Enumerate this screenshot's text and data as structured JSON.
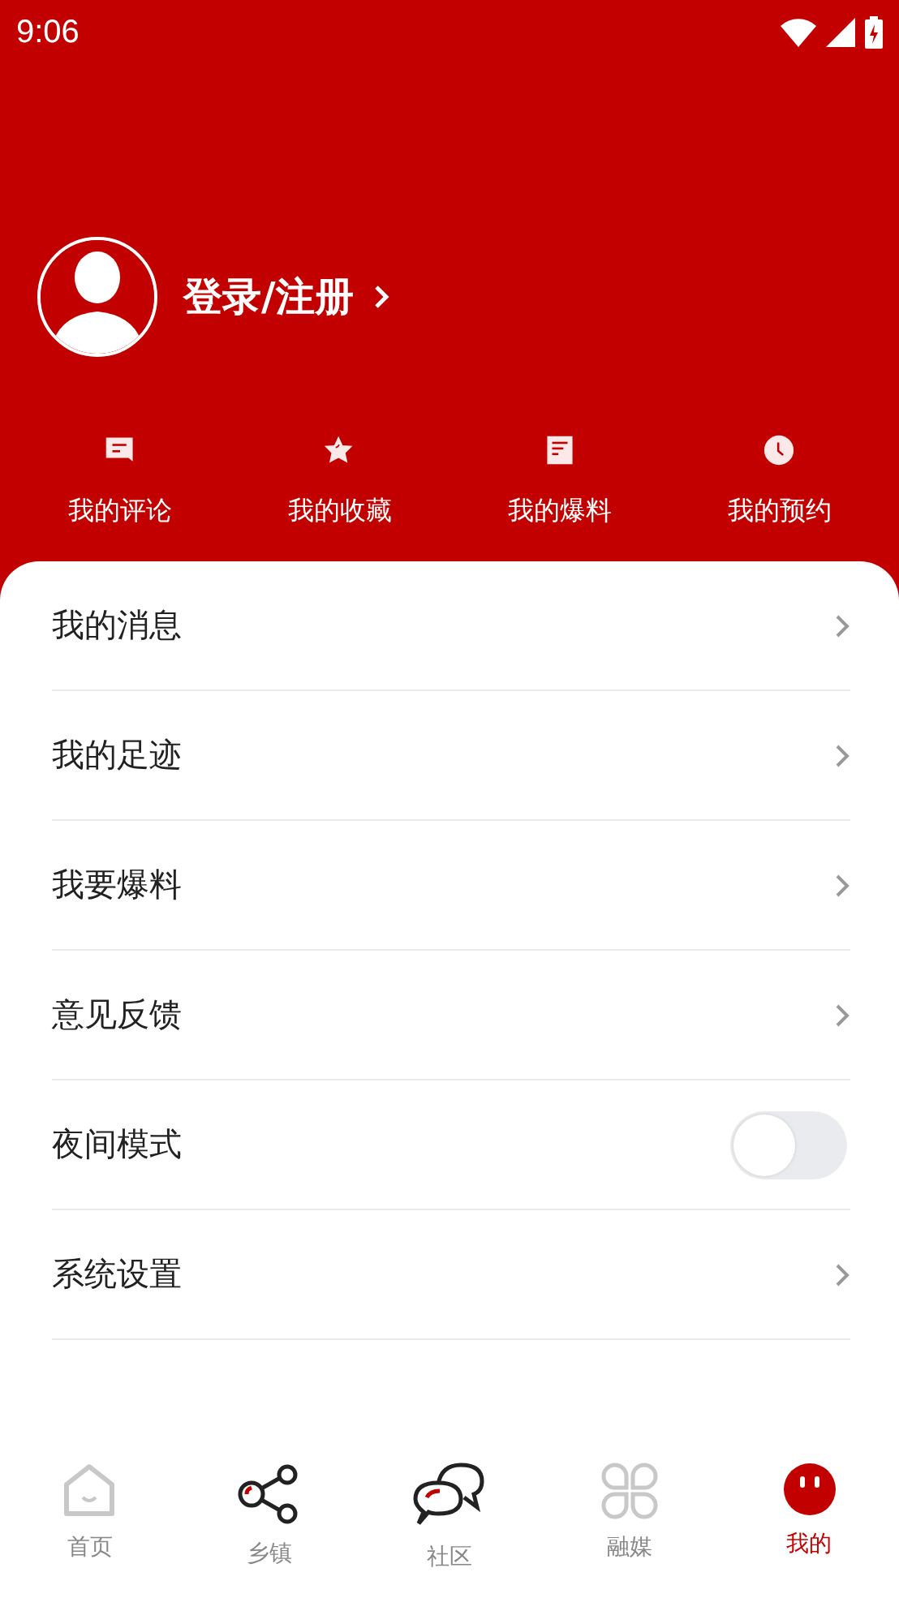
{
  "status_bar": {
    "time": "9:06"
  },
  "profile": {
    "login_label": "登录/注册"
  },
  "shortcuts": [
    {
      "label": "我的评论"
    },
    {
      "label": "我的收藏"
    },
    {
      "label": "我的爆料"
    },
    {
      "label": "我的预约"
    }
  ],
  "menu": [
    {
      "kind": "link",
      "label": "我的消息"
    },
    {
      "kind": "link",
      "label": "我的足迹"
    },
    {
      "kind": "link",
      "label": "我要爆料"
    },
    {
      "kind": "link",
      "label": "意见反馈"
    },
    {
      "kind": "toggle",
      "label": "夜间模式",
      "on": false
    },
    {
      "kind": "link",
      "label": "系统设置"
    }
  ],
  "tab_bar": [
    {
      "label": "首页",
      "selected": false
    },
    {
      "label": "乡镇",
      "selected": false
    },
    {
      "label": "社区",
      "selected": false
    },
    {
      "label": "融媒",
      "selected": false
    },
    {
      "label": "我的",
      "selected": true
    }
  ]
}
